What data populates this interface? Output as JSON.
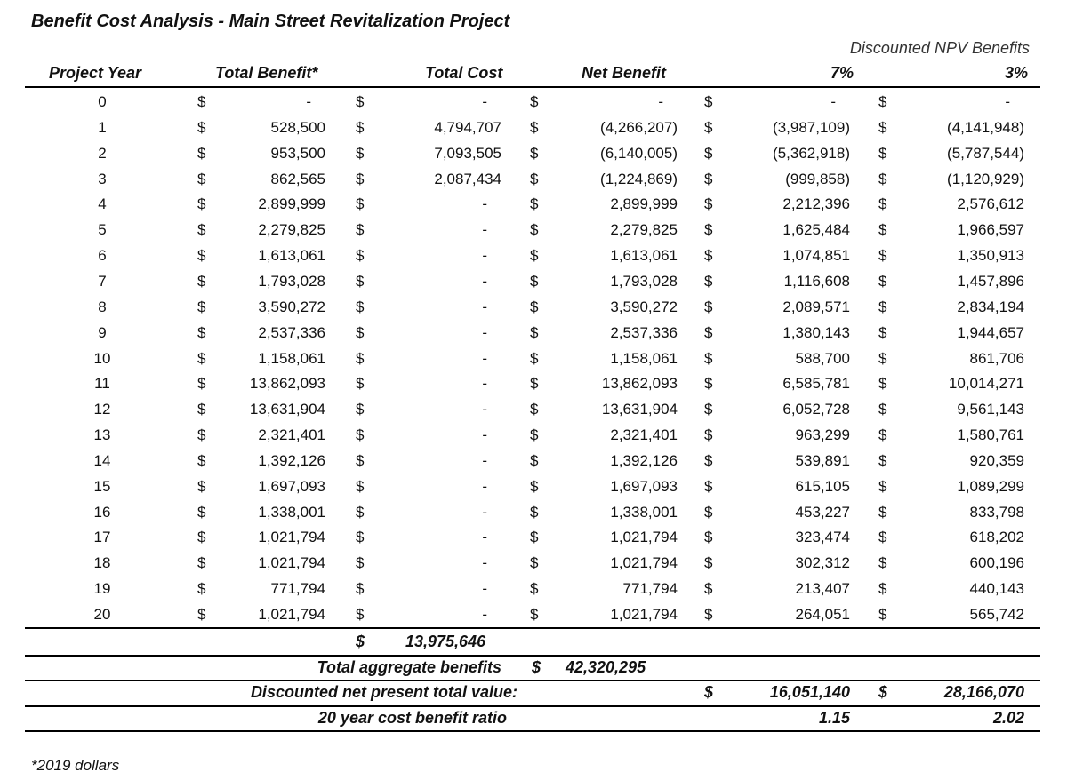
{
  "title": "Benefit Cost Analysis - Main Street Revitalization Project",
  "npv_header": "Discounted NPV Benefits",
  "headers": {
    "year": "Project Year",
    "benefit": "Total Benefit*",
    "cost": "Total Cost",
    "net": "Net Benefit",
    "rate7": "7%",
    "rate3": "3%"
  },
  "currency": "$",
  "rows": [
    {
      "year": "0",
      "benefit": "-",
      "cost": "-",
      "net": "-",
      "npv7": "-",
      "npv3": "-"
    },
    {
      "year": "1",
      "benefit": "528,500",
      "cost": "4,794,707",
      "net": "(4,266,207)",
      "npv7": "(3,987,109)",
      "npv3": "(4,141,948)"
    },
    {
      "year": "2",
      "benefit": "953,500",
      "cost": "7,093,505",
      "net": "(6,140,005)",
      "npv7": "(5,362,918)",
      "npv3": "(5,787,544)"
    },
    {
      "year": "3",
      "benefit": "862,565",
      "cost": "2,087,434",
      "net": "(1,224,869)",
      "npv7": "(999,858)",
      "npv3": "(1,120,929)"
    },
    {
      "year": "4",
      "benefit": "2,899,999",
      "cost": "-",
      "net": "2,899,999",
      "npv7": "2,212,396",
      "npv3": "2,576,612"
    },
    {
      "year": "5",
      "benefit": "2,279,825",
      "cost": "-",
      "net": "2,279,825",
      "npv7": "1,625,484",
      "npv3": "1,966,597"
    },
    {
      "year": "6",
      "benefit": "1,613,061",
      "cost": "-",
      "net": "1,613,061",
      "npv7": "1,074,851",
      "npv3": "1,350,913"
    },
    {
      "year": "7",
      "benefit": "1,793,028",
      "cost": "-",
      "net": "1,793,028",
      "npv7": "1,116,608",
      "npv3": "1,457,896"
    },
    {
      "year": "8",
      "benefit": "3,590,272",
      "cost": "-",
      "net": "3,590,272",
      "npv7": "2,089,571",
      "npv3": "2,834,194"
    },
    {
      "year": "9",
      "benefit": "2,537,336",
      "cost": "-",
      "net": "2,537,336",
      "npv7": "1,380,143",
      "npv3": "1,944,657"
    },
    {
      "year": "10",
      "benefit": "1,158,061",
      "cost": "-",
      "net": "1,158,061",
      "npv7": "588,700",
      "npv3": "861,706"
    },
    {
      "year": "11",
      "benefit": "13,862,093",
      "cost": "-",
      "net": "13,862,093",
      "npv7": "6,585,781",
      "npv3": "10,014,271"
    },
    {
      "year": "12",
      "benefit": "13,631,904",
      "cost": "-",
      "net": "13,631,904",
      "npv7": "6,052,728",
      "npv3": "9,561,143"
    },
    {
      "year": "13",
      "benefit": "2,321,401",
      "cost": "-",
      "net": "2,321,401",
      "npv7": "963,299",
      "npv3": "1,580,761"
    },
    {
      "year": "14",
      "benefit": "1,392,126",
      "cost": "-",
      "net": "1,392,126",
      "npv7": "539,891",
      "npv3": "920,359"
    },
    {
      "year": "15",
      "benefit": "1,697,093",
      "cost": "-",
      "net": "1,697,093",
      "npv7": "615,105",
      "npv3": "1,089,299"
    },
    {
      "year": "16",
      "benefit": "1,338,001",
      "cost": "-",
      "net": "1,338,001",
      "npv7": "453,227",
      "npv3": "833,798"
    },
    {
      "year": "17",
      "benefit": "1,021,794",
      "cost": "-",
      "net": "1,021,794",
      "npv7": "323,474",
      "npv3": "618,202"
    },
    {
      "year": "18",
      "benefit": "1,021,794",
      "cost": "-",
      "net": "1,021,794",
      "npv7": "302,312",
      "npv3": "600,196"
    },
    {
      "year": "19",
      "benefit": "771,794",
      "cost": "-",
      "net": "771,794",
      "npv7": "213,407",
      "npv3": "440,143"
    },
    {
      "year": "20",
      "benefit": "1,021,794",
      "cost": "-",
      "net": "1,021,794",
      "npv7": "264,051",
      "npv3": "565,742"
    }
  ],
  "summary": {
    "total_cost": "13,975,646",
    "aggregate_label": "Total aggregate benefits",
    "aggregate_value": "42,320,295",
    "npv_label": "Discounted net present total value:",
    "npv7": "16,051,140",
    "npv3": "28,166,070",
    "ratio_label": "20 year cost benefit ratio",
    "ratio7": "1.15",
    "ratio3": "2.02"
  },
  "footnote": "*2019 dollars"
}
